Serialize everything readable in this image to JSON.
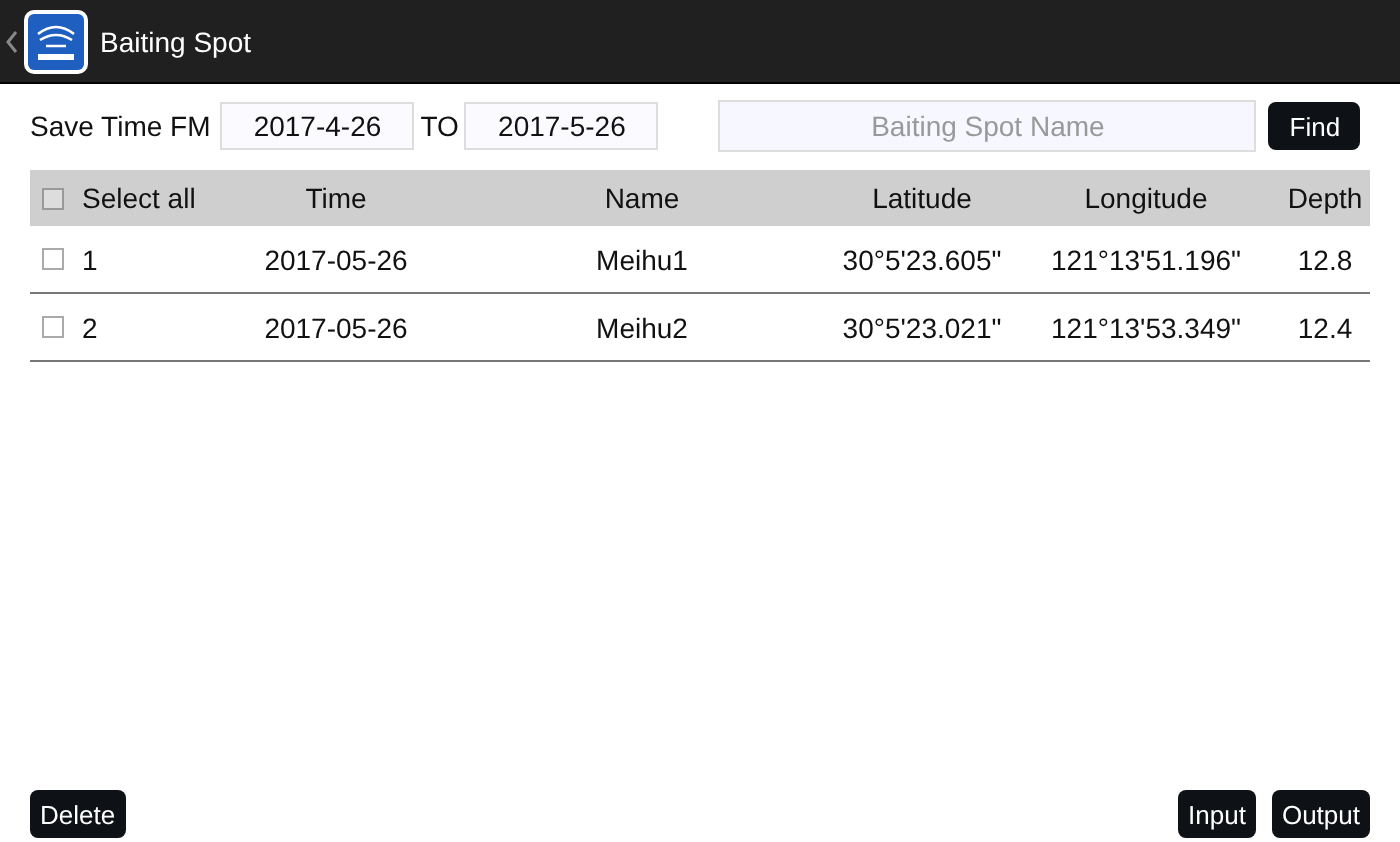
{
  "window": {
    "title": "Baiting Spot"
  },
  "filter": {
    "from_label": "Save Time FM",
    "from": "2017-4-26",
    "to_label": "TO",
    "to": "2017-5-26",
    "search_placeholder": "Baiting Spot Name",
    "find": "Find"
  },
  "table": {
    "select_all": {
      "label": "Select all",
      "checked": false
    },
    "columns": [
      "Time",
      "Name",
      "Latitude",
      "Longitude",
      "Depth"
    ],
    "rows": [
      {
        "index": "1",
        "checked": false,
        "cells": [
          "2017-05-26",
          "Meihu1",
          "30°5'23.605\"",
          "121°13'51.196\"",
          "12.8"
        ]
      },
      {
        "index": "2",
        "checked": false,
        "cells": [
          "2017-05-26",
          "Meihu2",
          "30°5'23.021\"",
          "121°13'53.349\"",
          "12.4"
        ]
      }
    ]
  },
  "buttons": {
    "delete": "Delete",
    "input": "Input",
    "output": "Output"
  }
}
